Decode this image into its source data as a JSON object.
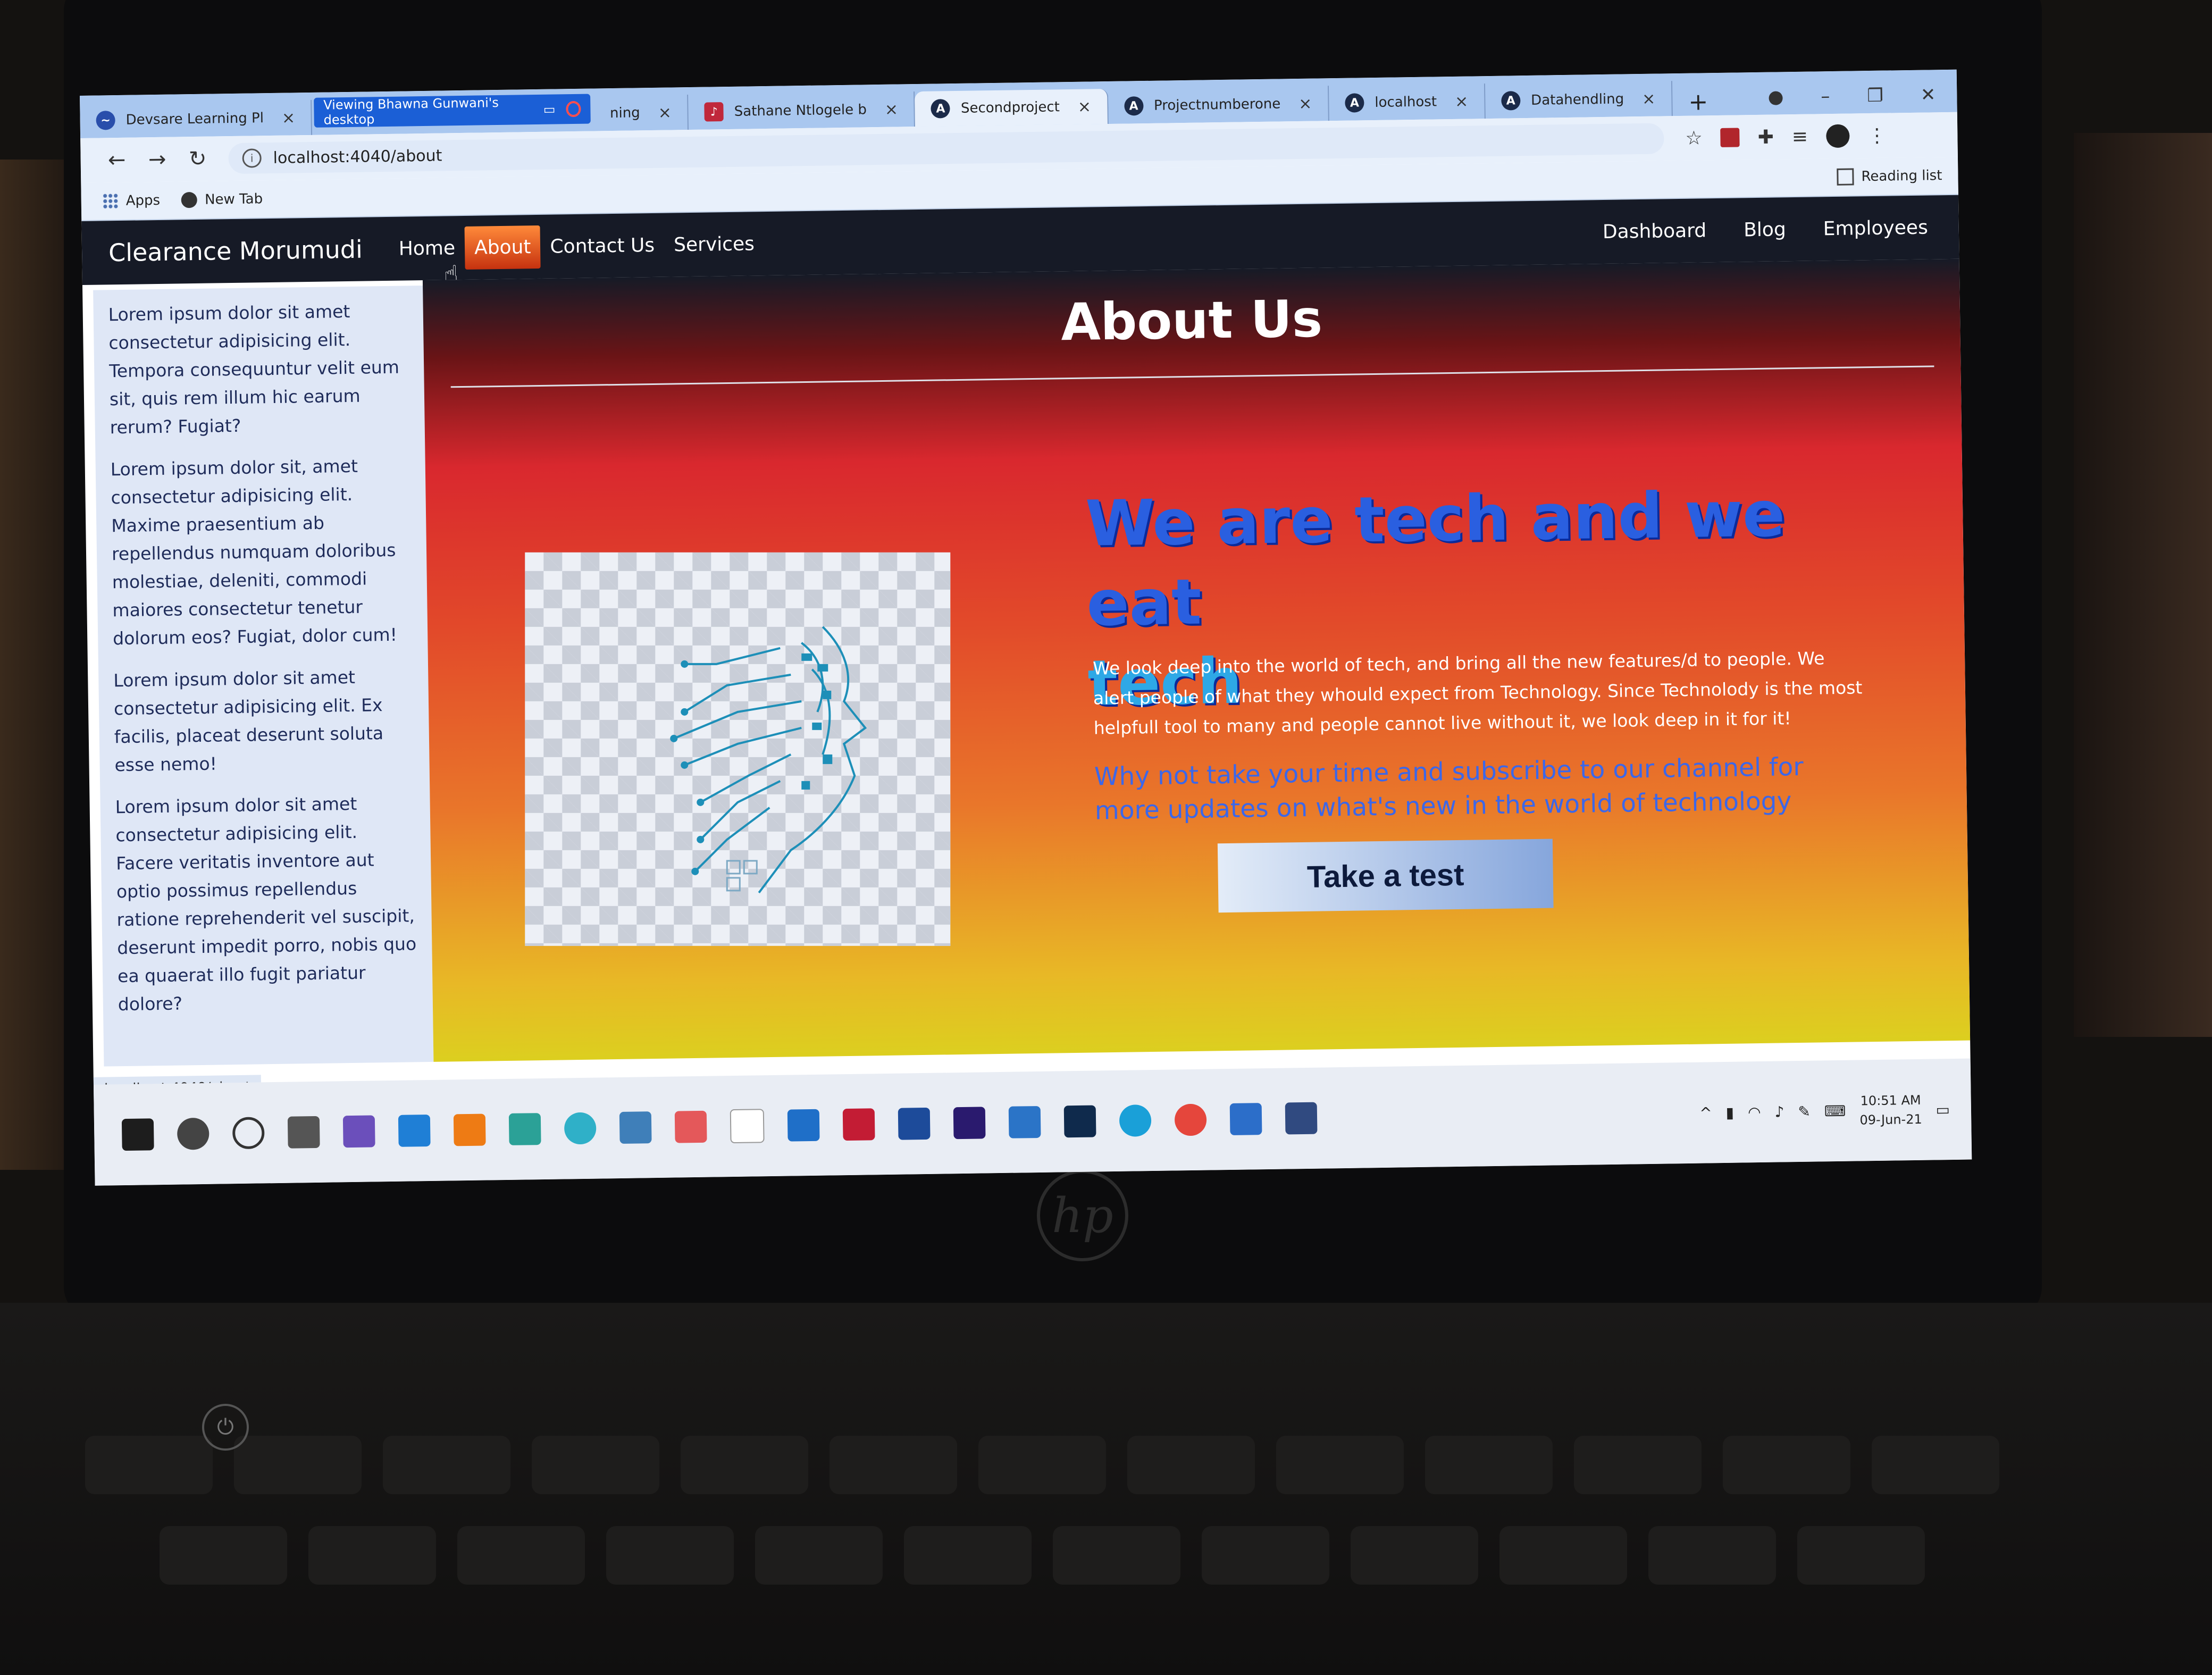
{
  "browser": {
    "tabs": [
      {
        "title": "Devsare Learning Pl",
        "active": false
      },
      {
        "title": "ning",
        "active": false
      },
      {
        "title": "Sathane Ntlogele b",
        "active": false
      },
      {
        "title": "Secondproject",
        "active": true
      },
      {
        "title": "Projectnumberone",
        "active": false
      },
      {
        "title": "localhost",
        "active": false
      },
      {
        "title": "Datahendling",
        "active": false
      }
    ],
    "share_banner": "Viewing Bhawna Gunwani's desktop",
    "url": "localhost:4040/about",
    "bookmarks": [
      "Apps",
      "New Tab"
    ],
    "reading_list": "Reading list",
    "status_url": "localhost:4040/about"
  },
  "site": {
    "brand": "Clearance Morumudi",
    "nav_left": [
      "Home",
      "About",
      "Contact Us",
      "Services"
    ],
    "active_nav": "About",
    "nav_right": [
      "Dashboard",
      "Blog",
      "Employees"
    ]
  },
  "sidebar": [
    "Lorem ipsum dolor sit amet consectetur adipisicing elit. Tempora consequuntur velit eum sit, quis rem illum hic earum rerum? Fugiat?",
    "Lorem ipsum dolor sit, amet consectetur adipisicing elit. Maxime praesentium ab repellendus numquam doloribus molestiae, deleniti, commodi maiores consectetur tenetur dolorum eos? Fugiat, dolor cum!",
    "Lorem ipsum dolor sit amet consectetur adipisicing elit. Ex facilis, placeat deserunt soluta esse nemo!",
    "Lorem ipsum dolor sit amet consectetur adipisicing elit. Facere veritatis inventore aut optio possimus repellendus ratione reprehenderit vel suscipit, deserunt impedit porro, nobis quo ea quaerat illo fugit pariatur dolore?"
  ],
  "main": {
    "title": "About Us",
    "headline_line1": "We are tech and we eat",
    "headline_line2": "tech",
    "paragraph": "We look deep into the world of tech, and bring all the new features/d to people. We alert people of what they whould expect from Technology. Since Technolody is the most helpfull tool to many and people cannot live without it, we look deep in it for it!",
    "subtext": "Why not take your time and subscribe to our channel for more updates on what's new in the world of technology",
    "cta_label": "Take a test"
  },
  "taskbar": {
    "time": "10:51 AM",
    "date": "09-Jun-21"
  },
  "colors": {
    "navbar": "#161a26",
    "gradient_top": "#d9282e",
    "gradient_bottom": "#dccf1f",
    "headline": "#2a5fe0",
    "sidebar_bg": "#dfe7f6"
  }
}
